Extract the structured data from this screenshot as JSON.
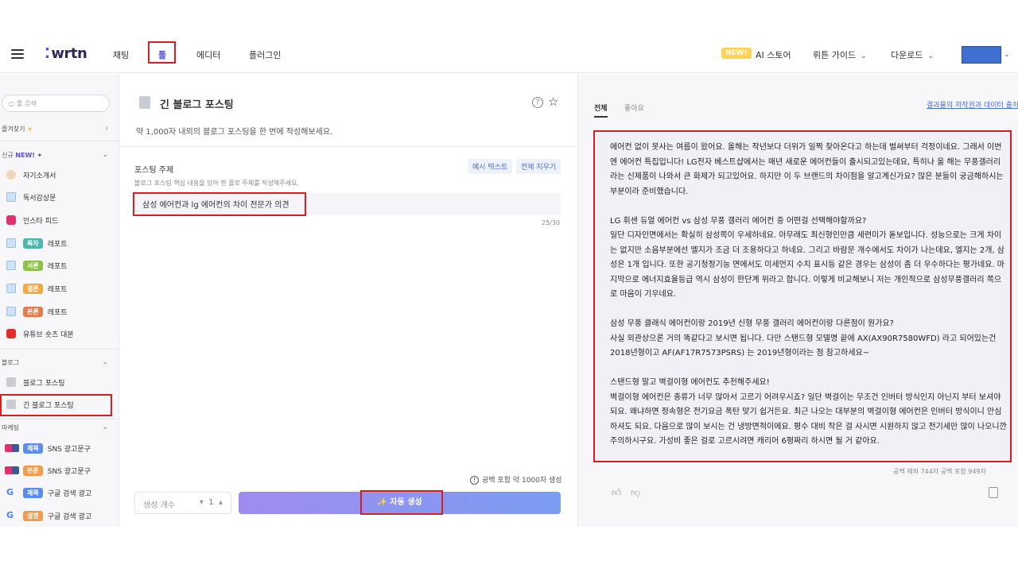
{
  "header": {
    "logo": "wrtn",
    "nav": [
      "채팅",
      "툴",
      "에디터",
      "플러그인"
    ],
    "new_badge": "NEW!",
    "ai_store": "AI 스토어",
    "guide": "뤼튼 가이드",
    "download": "다운로드"
  },
  "sidebar": {
    "search_placeholder": "툴 검색",
    "favorites": "즐겨찾기",
    "favorites_star": "★",
    "new_section": "신규",
    "new_tag": "NEW!",
    "items_new": [
      {
        "label": "자기소개서"
      },
      {
        "label": "독서감상문"
      },
      {
        "label": "인스타 피드"
      },
      {
        "pill": "목차",
        "label": "레포트"
      },
      {
        "pill": "서론",
        "label": "레포트"
      },
      {
        "pill": "결론",
        "label": "레포트"
      },
      {
        "pill": "본론",
        "label": "레포트"
      },
      {
        "label": "유튜브 숏츠 대본"
      }
    ],
    "blog_section": "블로그",
    "items_blog": [
      {
        "label": "블로그 포스팅"
      },
      {
        "label": "긴 블로그 포스팅"
      }
    ],
    "marketing_section": "마케팅",
    "items_marketing": [
      {
        "pill": "제목",
        "label": "SNS 광고문구"
      },
      {
        "pill": "본문",
        "label": "SNS 광고문구"
      },
      {
        "pill": "제목",
        "label": "구글 검색 광고"
      },
      {
        "pill": "설명",
        "label": "구글 검색 광고"
      }
    ]
  },
  "tool": {
    "title": "긴 블로그 포스팅",
    "description": "약 1,000자 내외의 블로그 포스팅을 한 번에 작성해보세요.",
    "topic_label": "포스팅 주제",
    "example_button": "예시 텍스트",
    "clear_button": "전체 지우기",
    "topic_hint": "블로그 포스팅 핵심 내용을 담아 한 줄로 주제를 작성해주세요.",
    "topic_value": "삼성 에어컨과 lg 에어컨의 차이 전문가 의견",
    "counter": "25/30",
    "gen_note": "공백 포함 약 1000자 생성",
    "count_label": "생성 개수",
    "count_value": "1",
    "generate_button": "자동 생성"
  },
  "result": {
    "tabs": [
      "전체",
      "좋아요"
    ],
    "copyright_link": "결과물의 저작권과 데이터 출처",
    "paragraphs": [
      "에어컨 없이 못사는 여름이 왔어요. 올해는 작년보다 더위가 일찍 찾아온다고 하는데 벌써부터 걱정이네요. 그래서 이번엔 에어컨 특집입니다! LG전자 베스트샵에서는 매년 새로운 에어컨들이 출시되고있는데요, 특히나 올 해는 무풍갤러리라는 신제품이 나와서 큰 화제가 되고있어요. 하지만 이 두 브랜드의 차이점을 알고계신가요? 많은 분들이 궁금해하시는 부분이라 준비했습니다.",
      "LG 휘센 듀얼 에어컨 vs 삼성 무풍 갤러리 에어컨 중 어떤걸 선택해야할까요?\n일단 디자인면에서는 확실히 삼성쪽이 우세하네요. 아무래도 최신형인만큼 세련미가 돋보입니다. 성능으로는 크게 차이는 없지만 소음부분에선 엘지가 조금 더 조용하다고 하네요. 그리고 바람문 개수에서도 차이가 나는데요, 엘지는 2개, 삼성은 1개 입니다. 또한 공기청정기능 면에서도 미세먼지 수치 표시등 같은 경우는 삼성이 좀 더 우수하다는 평가네요. 마지막으로 에너지효율등급 역시 삼성이 한단계 위라고 합니다. 이렇게 비교해보니 저는 개인적으로 삼성무풍갤러리 쪽으로 마음이 기우네요.",
      "삼성 무풍 클래식 에어컨이랑 2019년 신형 무풍 갤러리 에어컨이랑 다른점이 뭔가요?\n사실 외관상으론 거의 똑같다고 보시면 됩니다. 다만 스탠드형 모델명 끝에 AX(AX90R7580WFD) 라고 되어있는건 2018년형이고 AF(AF17R7573PSRS) 는 2019년형이라는 점 참고하세요~",
      "스탠드형 말고 벽걸이형 에어컨도 추천해주세요!\n벽걸이형 에어컨은 종류가 너무 많아서 고르기 어려우시죠? 일단 벽걸이는 무조건 인버터 방식인지 아닌지 부터 보셔야되요. 왜냐하면 정속형은 전기요금 폭탄 맞기 쉽거든요. 최근 나오는 대부분의 벽걸이형 에어컨은 인버터 방식이니 안심하셔도 되요. 다음으로 많이 보시는 건 냉방면적이에요. 평수 대비 작은 걸 사시면 시원하지 않고 전기세만 많이 나오니깐 주의하시구요. 가성비 좋은 걸로 고르시려면 캐리어 6평짜리 하시면 될 거 같아요."
    ],
    "stats": "공백 제외 744자  공백 포함 949자"
  },
  "colors": {
    "accent": "#5a4fd0",
    "highlight_box": "#d81e1e",
    "badge": "#ffd34d"
  }
}
